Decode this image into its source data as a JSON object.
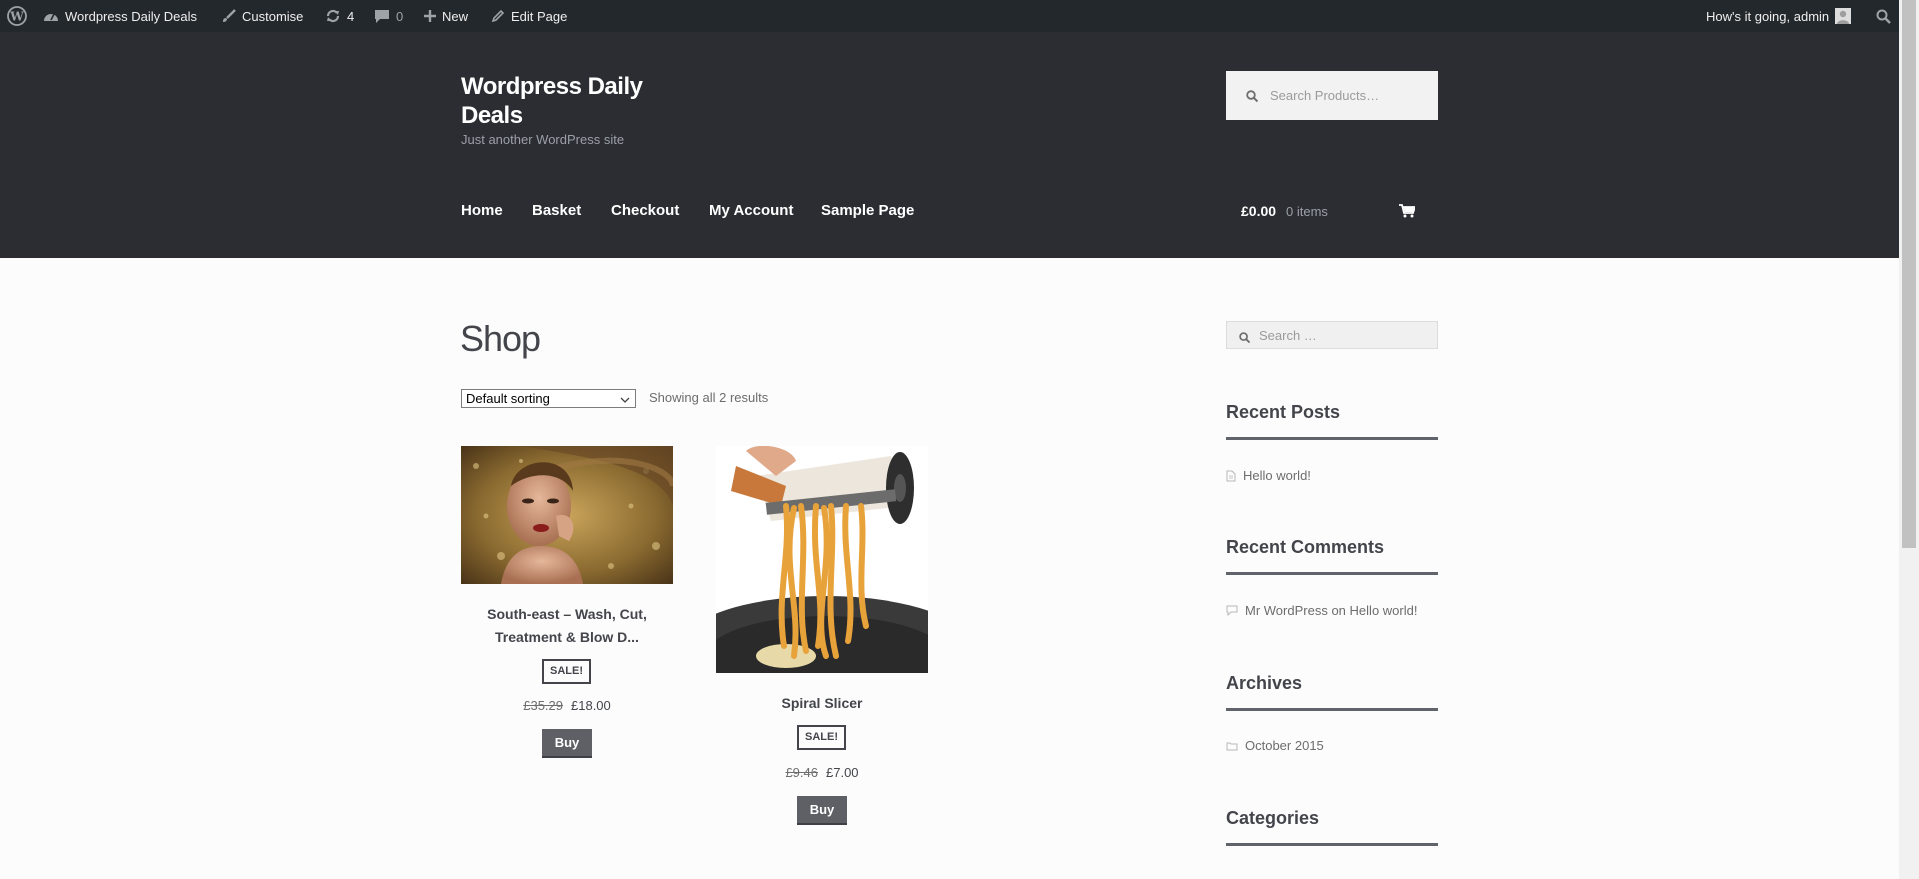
{
  "admin_bar": {
    "site_name": "Wordpress Daily Deals",
    "customise": "Customise",
    "updates_count": "4",
    "comments_count": "0",
    "new_label": "New",
    "edit_page": "Edit Page",
    "greeting": "How's it going, admin"
  },
  "header": {
    "site_title": "Wordpress Daily Deals",
    "tagline": "Just another WordPress site",
    "search_placeholder": "Search Products…",
    "nav": [
      "Home",
      "Basket",
      "Checkout",
      "My Account",
      "Sample Page"
    ],
    "cart_total": "£0.00",
    "cart_count": "0 items"
  },
  "main": {
    "title": "Shop",
    "sorting_selected": "Default sorting",
    "result_count": "Showing all 2 results",
    "products": [
      {
        "name_line1": "South-east – Wash, Cut,",
        "name_line2": "Treatment & Blow D...",
        "sale_badge": "SALE!",
        "old_price": "£35.29",
        "new_price": "£18.00",
        "button": "Buy"
      },
      {
        "name_line1": "Spiral Slicer",
        "sale_badge": "SALE!",
        "old_price": "£9.46",
        "new_price": "£7.00",
        "button": "Buy"
      }
    ]
  },
  "sidebar": {
    "search_placeholder": "Search …",
    "recent_posts_title": "Recent Posts",
    "recent_posts": [
      "Hello world!"
    ],
    "recent_comments_title": "Recent Comments",
    "comment_author": "Mr WordPress",
    "comment_on": "on",
    "comment_post": "Hello world!",
    "archives_title": "Archives",
    "archives": [
      "October 2015"
    ],
    "categories_title": "Categories"
  },
  "colors": {
    "admin_bar_bg": "#23282d",
    "header_bg": "#2c2d33",
    "button_bg": "#5e6066",
    "text": "#43454b"
  }
}
